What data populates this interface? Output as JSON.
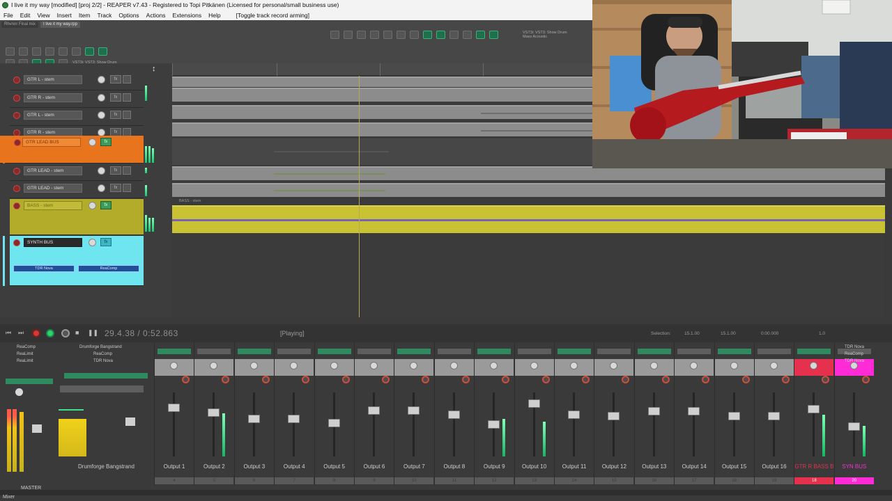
{
  "window": {
    "title": "I live it my way [modified] [proj 2/2] - REAPER v7.43 - Registered to Topi Pitkänen (Licensed for personal/small business use)"
  },
  "menu": {
    "items": [
      "File",
      "Edit",
      "View",
      "Insert",
      "Item",
      "Track",
      "Options",
      "Actions",
      "Extensions",
      "Help"
    ],
    "toggle_label": "[Toggle track record arming]"
  },
  "project_tabs": [
    "Rhvnnr Final mix",
    "I live it my way.rpp"
  ],
  "toolbar": {
    "vst_label_right": "VST3i: VST3: Show Drum Mass Acoustic",
    "vst_label_left": "VST3i: VST3: Show Drum Mass Acoustic"
  },
  "tracks": [
    {
      "name": "GTR L - stem",
      "color": "grey"
    },
    {
      "name": "GTR R - stem",
      "color": "grey"
    },
    {
      "name": "GTR L - stem",
      "color": "grey"
    },
    {
      "name": "GTR R - stem",
      "color": "grey"
    },
    {
      "name": "GTR LEAD BUS",
      "color": "orange"
    },
    {
      "name": "GTR LEAD - stem",
      "color": "grey"
    },
    {
      "name": "GTR LEAD - stem",
      "color": "grey"
    },
    {
      "name": "BASS - stem",
      "color": "olive"
    },
    {
      "name": "SYNTH BUS",
      "color": "cyan"
    }
  ],
  "synth_bus_fx": [
    "TDR Nova",
    "ReaComp"
  ],
  "bass_item_label": "BASS - stem",
  "transport": {
    "time": "29.4.38 / 0:52.863",
    "state": "[Playing]",
    "selection_label": "Selection:",
    "selection_start": "15.1.00",
    "selection_end": "15.1.00",
    "selection_length": "0:00.000",
    "rate": "1.0"
  },
  "mixer": {
    "master_fx": [
      "ReaComp",
      "ReaLimit",
      "ReaLimit"
    ],
    "master_label": "MASTER",
    "drum_fx": [
      "Drumforge Bangstrand",
      "ReaComp",
      "TDR Nova"
    ],
    "drum_label": "Drumforge Bangstrand",
    "right_fx": [
      "TDR Nova",
      "ReaComp",
      "TDR Nova"
    ],
    "strips": [
      "Output 1",
      "Output 2",
      "Output 3",
      "Output 4",
      "Output 5",
      "Output 6",
      "Output 7",
      "Output 8",
      "Output 9",
      "Output 10",
      "Output 11",
      "Output 12",
      "Output 13",
      "Output 14",
      "Output 15",
      "Output 16",
      "GTR R BASS BUS",
      "SYN BUS"
    ],
    "strip_numbers": [
      "4",
      "5",
      "6",
      "7",
      "8",
      "9",
      "10",
      "11",
      "12",
      "13",
      "14",
      "15",
      "16",
      "17",
      "18",
      "19",
      "18",
      "20"
    ],
    "highlight_colors": {
      "red": "#e5314d",
      "pink": "#ff2bd6",
      "cyan": "#6fe5f0",
      "orange": "#e8751e",
      "olive": "#b3ac2a"
    }
  },
  "status_tab": "Mixer"
}
